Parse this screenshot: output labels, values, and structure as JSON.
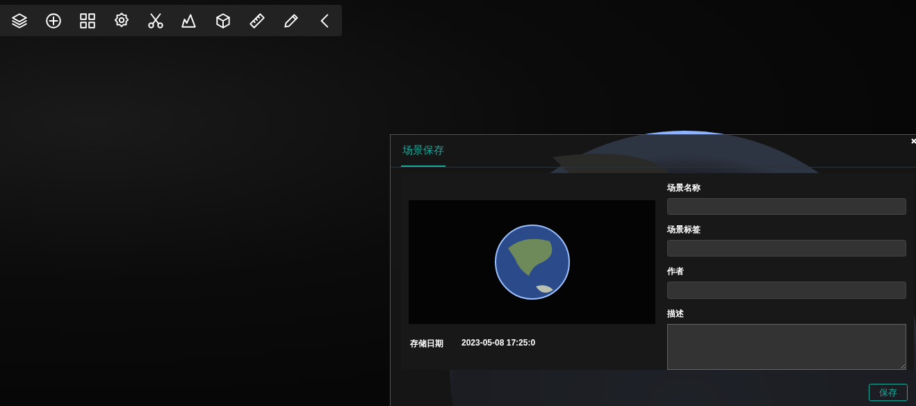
{
  "dialog": {
    "tabs": [
      {
        "label": "场景保存",
        "selected": true
      }
    ],
    "preview": {
      "date_label": "存储日期",
      "date_value": "2023-05-08 17:25:0"
    },
    "fields": [
      {
        "label": "场景名称",
        "kind": "input"
      },
      {
        "label": "场景标签",
        "kind": "input"
      },
      {
        "label": "作者",
        "kind": "input"
      },
      {
        "label": "描述",
        "kind": "textarea"
      }
    ],
    "save_button": "保存"
  }
}
